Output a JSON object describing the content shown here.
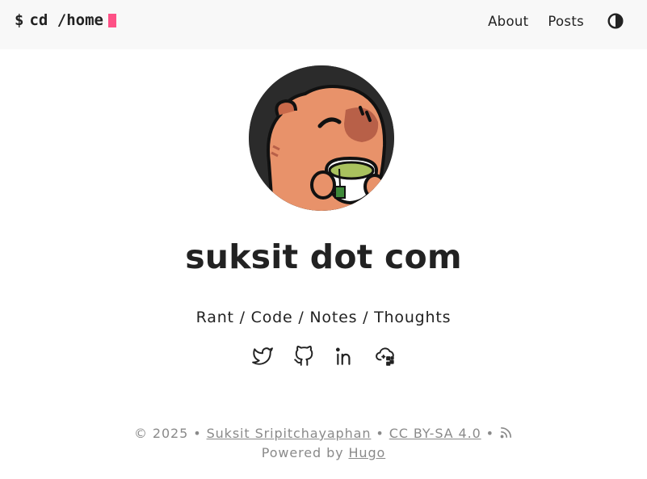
{
  "header": {
    "brand_prompt": "$",
    "brand_path": "cd /home",
    "nav": [
      {
        "label": "About"
      },
      {
        "label": "Posts"
      }
    ],
    "theme_toggle_icon": "contrast-icon"
  },
  "profile": {
    "avatar_icon": "capybara-avatar-image",
    "title": "suksit dot com",
    "tagline": "Rant / Code / Notes / Thoughts"
  },
  "socials": [
    {
      "icon": "twitter-icon"
    },
    {
      "icon": "github-icon"
    },
    {
      "icon": "linkedin-icon"
    },
    {
      "icon": "keybase-icon"
    }
  ],
  "footer": {
    "copyright": "© 2025",
    "separator": "•",
    "author": "Suksit Sripitchayaphan",
    "license": "CC BY-SA 4.0",
    "rss_icon": "rss-icon",
    "powered_by": "Powered by",
    "engine": "Hugo"
  },
  "colors": {
    "accent_cursor": "#fe5186",
    "header_bg": "#f8f8f8",
    "text": "#222222",
    "muted": "#8a8a8a"
  }
}
